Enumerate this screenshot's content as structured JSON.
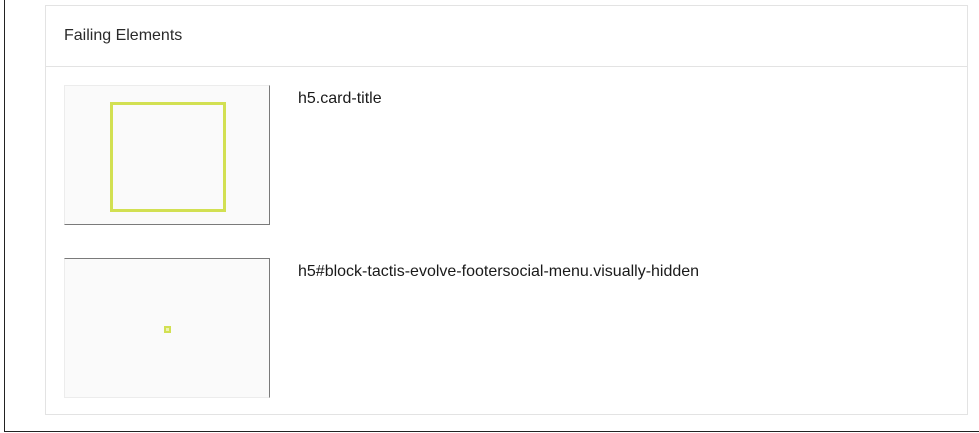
{
  "panel": {
    "title": "Failing Elements"
  },
  "failing_elements": [
    {
      "selector": "h5.card-title",
      "highlight_color": "#d2e052",
      "thumbnail": "element-highlight-box"
    },
    {
      "selector": "h5#block-tactis-evolve-footersocial-menu.visually-hidden",
      "highlight_color": "#d2e052",
      "thumbnail": "element-highlight-dot"
    }
  ]
}
